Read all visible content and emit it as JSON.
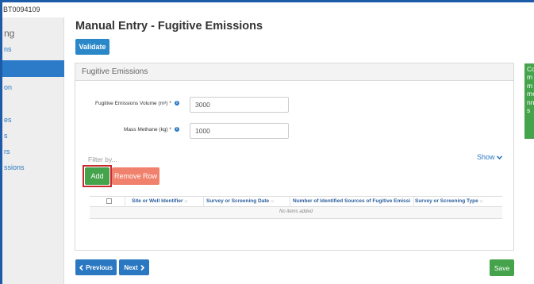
{
  "record": {
    "id": "BT0094109"
  },
  "sidebar": {
    "heading": "ng",
    "items": [
      {
        "label": "ns"
      },
      {
        "label": "on"
      },
      {
        "label": "es"
      },
      {
        "label": "s"
      },
      {
        "label": "rs"
      },
      {
        "label": "ssions"
      }
    ]
  },
  "page": {
    "title": "Manual Entry - Fugitive Emissions"
  },
  "toolbar": {
    "validate_label": "Validate"
  },
  "panel": {
    "title": "Fugitive Emissions"
  },
  "form": {
    "volume": {
      "label": "Fugitive Emissions Volume (m³) *",
      "value": "3000"
    },
    "methane": {
      "label": "Mass Methane (kg) *",
      "value": "1000"
    }
  },
  "filter": {
    "label": "Filter by...",
    "show_label": "Show"
  },
  "actions": {
    "add_label": "Add",
    "remove_label": "Remove Row"
  },
  "table": {
    "columns": [
      "Site or Well Identifier",
      "Survey or Screening Date",
      "Number of Identified Sources of Fugitive Emissi",
      "Survey or Screening Type"
    ],
    "empty_text": "No items added"
  },
  "nav": {
    "previous_label": "Previous",
    "next_label": "Next",
    "save_label": "Save"
  },
  "side_note": {
    "text": "Commmennts"
  },
  "colors": {
    "primary": "#2b78c2",
    "success": "#45a34b",
    "danger": "#f0816c",
    "highlight": "#c8292e"
  },
  "icons": {
    "info": "info-icon",
    "chevron_down": "chevron-down-icon",
    "chevron_left": "chevron-left-icon",
    "chevron_right": "chevron-right-icon",
    "sort": "sort-icon"
  }
}
